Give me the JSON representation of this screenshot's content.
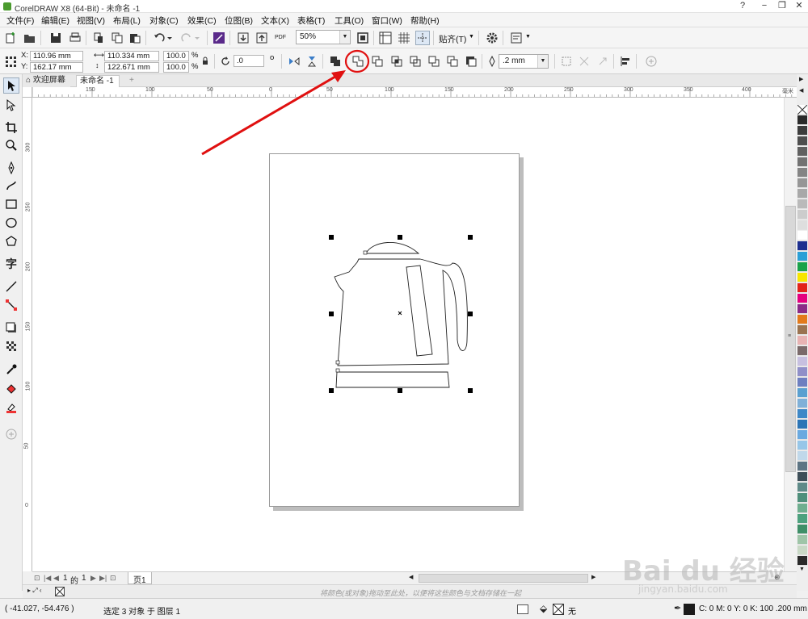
{
  "window": {
    "title": "CorelDRAW X8 (64-Bit) - 未命名 -1",
    "controls": [
      "?",
      "−",
      "❐",
      "✕"
    ]
  },
  "menu": [
    "文件(F)",
    "编辑(E)",
    "视图(V)",
    "布局(L)",
    "对象(C)",
    "效果(C)",
    "位图(B)",
    "文本(X)",
    "表格(T)",
    "工具(O)",
    "窗口(W)",
    "帮助(H)"
  ],
  "toolbar": {
    "zoom": "50%",
    "snap_label": "贴齐(T)",
    "pdf_label": "PDF"
  },
  "property_bar": {
    "x_label": "X:",
    "x_value": "110.96 mm",
    "y_label": "Y:",
    "y_value": "162.17 mm",
    "w_value": "110.334 mm",
    "h_value": "122.671 mm",
    "scale_x": "100.0",
    "scale_y": "100.0",
    "pct": "%",
    "rotation": ".0",
    "outline_width": ".2 mm"
  },
  "tabs": {
    "welcome": "欢迎屏幕",
    "document": "未命名 -1",
    "add": "+"
  },
  "ruler": {
    "h_ticks": [
      "150",
      "100",
      "50",
      "0",
      "50",
      "100",
      "150",
      "200",
      "250",
      "300",
      "350",
      "400"
    ],
    "v_ticks": [
      "300",
      "250",
      "200",
      "150",
      "100",
      "50",
      "0"
    ],
    "unit": "毫米"
  },
  "page_nav": {
    "current": "1",
    "of": "的",
    "total": "1",
    "page_tab": "页1"
  },
  "color_bar_hint": "将颜色(或对象)拖动至此处，以便将这些颜色与文档存储在一起",
  "status": {
    "coords": "( -41.027, -54.476 )",
    "selection": "选定 3 对象 于 图层 1",
    "fill_none": "无",
    "outline_info": "C: 0 M: 0 Y: 0 K: 100  .200 mm"
  },
  "palette_colors": [
    "#ffffff",
    "#2a2a2a",
    "#3c3c3c",
    "#4e4e4e",
    "#606060",
    "#727272",
    "#848484",
    "#969696",
    "#a8a8a8",
    "#bababa",
    "#cccccc",
    "#dedede",
    "#ffffff",
    "#1d2f8f",
    "#2a9fd6",
    "#1aa24a",
    "#f7e600",
    "#e2231a",
    "#e4007f",
    "#8a2b87",
    "#e37a1b",
    "#9a7350",
    "#e8b3b3",
    "#7a6a6a",
    "#c7c0e0",
    "#8f8fc8",
    "#6d7fc0",
    "#5aa0d0",
    "#7fb0d8",
    "#3e88c7",
    "#2c75b6",
    "#6aa9e0",
    "#96c6e8",
    "#c0d8ea",
    "#5d7483",
    "#3e4e58",
    "#5f8a88",
    "#4f8f7b",
    "#6fae8f",
    "#4da17e",
    "#3f8f68",
    "#9fc5a8",
    "#c9d9c6",
    "#2a2a2a"
  ],
  "accent": {
    "annotation_red": "#e01010",
    "selection_black": "#000000"
  }
}
